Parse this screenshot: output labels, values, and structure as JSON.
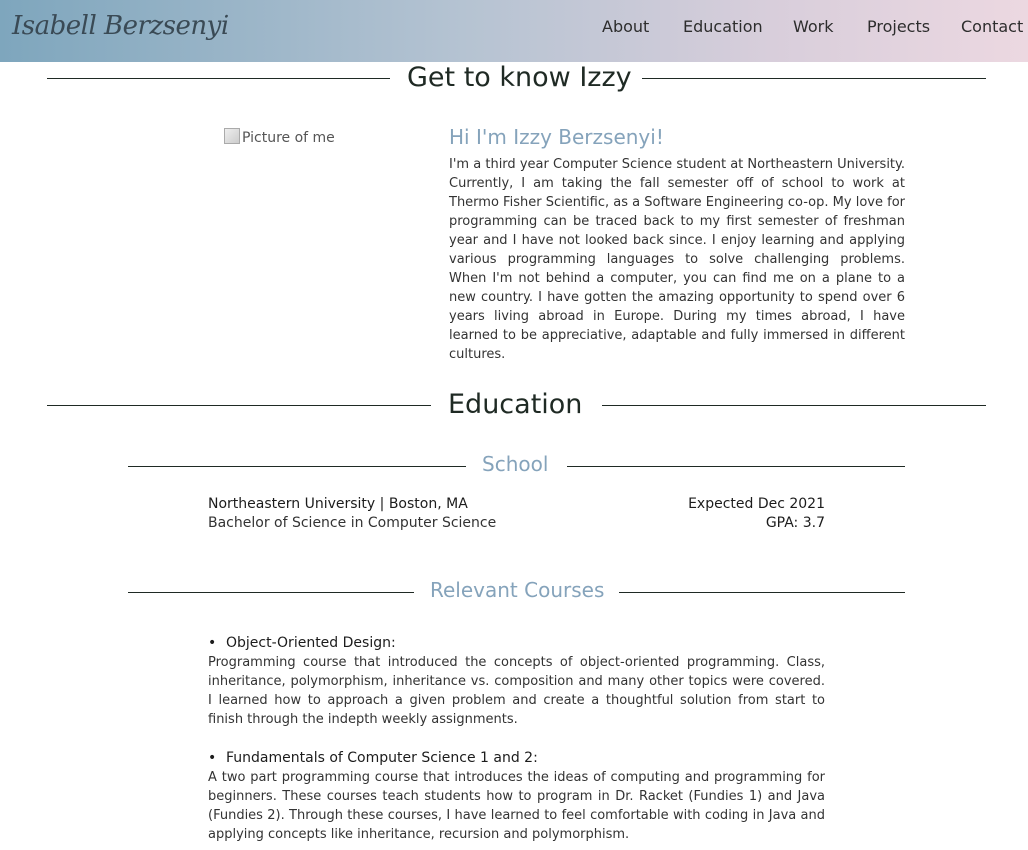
{
  "nav": {
    "brand": "Isabell Berzsenyi",
    "links": [
      "About",
      "Education",
      "Work",
      "Projects",
      "Contact"
    ]
  },
  "about": {
    "heading": "Get to know Izzy",
    "image_alt": "Picture of me",
    "greeting": "Hi I'm Izzy Berzsenyi!",
    "intro": "I'm a third year Computer Science student at Northeastern University. Currently, I am taking the fall semester off of school to work at Thermo Fisher Scientific, as a Software Engineering co-op. My love for programming can be traced back to my first semester of freshman year and I have not looked back since. I enjoy learning and applying various programming languages to solve challenging problems. When I'm not behind a computer, you can find me on a plane to a new country. I have gotten the amazing opportunity to spend over 6 years living abroad in Europe. During my times abroad, I have learned to be appreciative, adaptable and fully immersed in different cultures."
  },
  "education": {
    "heading": "Education",
    "school_heading": "School",
    "school": {
      "name": "Northeastern University | Boston, MA",
      "degree": "Bachelor of Science in Computer Science",
      "date": "Expected Dec 2021",
      "gpa": "GPA: 3.7"
    },
    "courses_heading": "Relevant Courses",
    "courses": [
      {
        "title": "Object-Oriented Design:",
        "description": "Programming course that introduced the concepts of object-oriented programming. Class, inheritance, polymorphism, inheritance vs. composition and many other topics were covered. I learned how to approach a given problem and create a thoughtful solution from start to finish through the indepth weekly assignments."
      },
      {
        "title": "Fundamentals of Computer Science 1 and 2:",
        "description": "A two part programming course that introduces the ideas of computing and programming for beginners. These courses teach students how to program in Dr. Racket (Fundies 1) and Java (Fundies 2). Through these courses, I have learned to feel comfortable with coding in Java and applying concepts like inheritance, recursion and polymorphism."
      }
    ]
  }
}
